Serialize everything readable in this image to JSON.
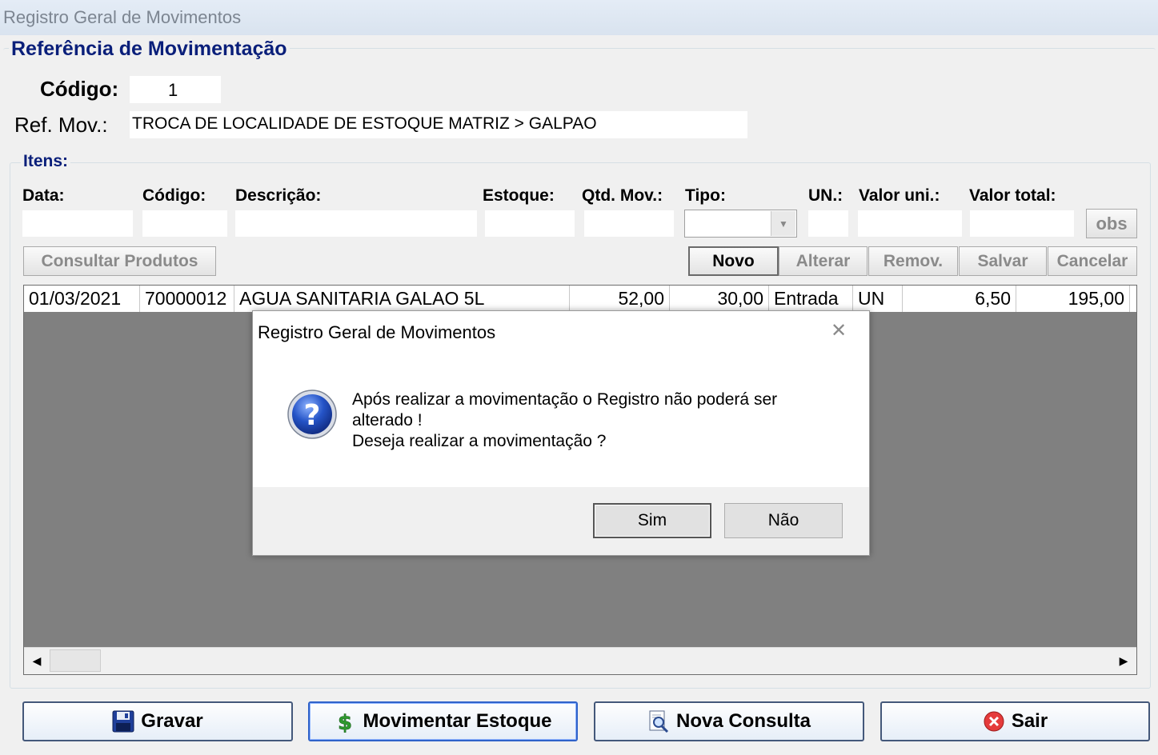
{
  "window": {
    "title": "Registro Geral de Movimentos"
  },
  "referencia": {
    "legend": "Referência de Movimentação",
    "codigo_label": "Código:",
    "codigo_value": "1",
    "refmov_label": "Ref. Mov.:",
    "refmov_value": "TROCA DE LOCALIDADE DE ESTOQUE MATRIZ > GALPAO"
  },
  "itens": {
    "legend": "Itens:",
    "labels": {
      "data": "Data:",
      "codigo": "Código:",
      "descricao": "Descrição:",
      "estoque": "Estoque:",
      "qtd": "Qtd. Mov.:",
      "tipo": "Tipo:",
      "un": "UN.:",
      "valor_uni": "Valor uni.:",
      "valor_total": "Valor total:"
    },
    "obs_button": "obs",
    "consultar_button": "Consultar Produtos",
    "actions": {
      "novo": "Novo",
      "alterar": "Alterar",
      "remov": "Remov.",
      "salvar": "Salvar",
      "cancelar": "Cancelar"
    }
  },
  "grid": {
    "rows": [
      {
        "data": "01/03/2021",
        "codigo": "70000012",
        "descricao": "AGUA SANITARIA GALAO 5L",
        "estoque": "52,00",
        "qtd": "30,00",
        "tipo": "Entrada",
        "un": "UN",
        "valor_uni": "6,50",
        "valor_total": "195,00"
      }
    ]
  },
  "dialog": {
    "title": "Registro Geral de Movimentos",
    "message_lines": [
      "Após realizar a movimentação o Registro não poderá ser",
      "alterado !",
      "Deseja realizar a movimentação ?"
    ],
    "yes": "Sim",
    "no": "Não",
    "icon": "question-icon"
  },
  "bottom_buttons": {
    "gravar": "Gravar",
    "movimentar": "Movimentar Estoque",
    "nova_consulta": "Nova Consulta",
    "sair": "Sair"
  },
  "colors": {
    "legend": "#0a1f7a",
    "grid_bg": "#808080",
    "button_border": "#44587a"
  }
}
